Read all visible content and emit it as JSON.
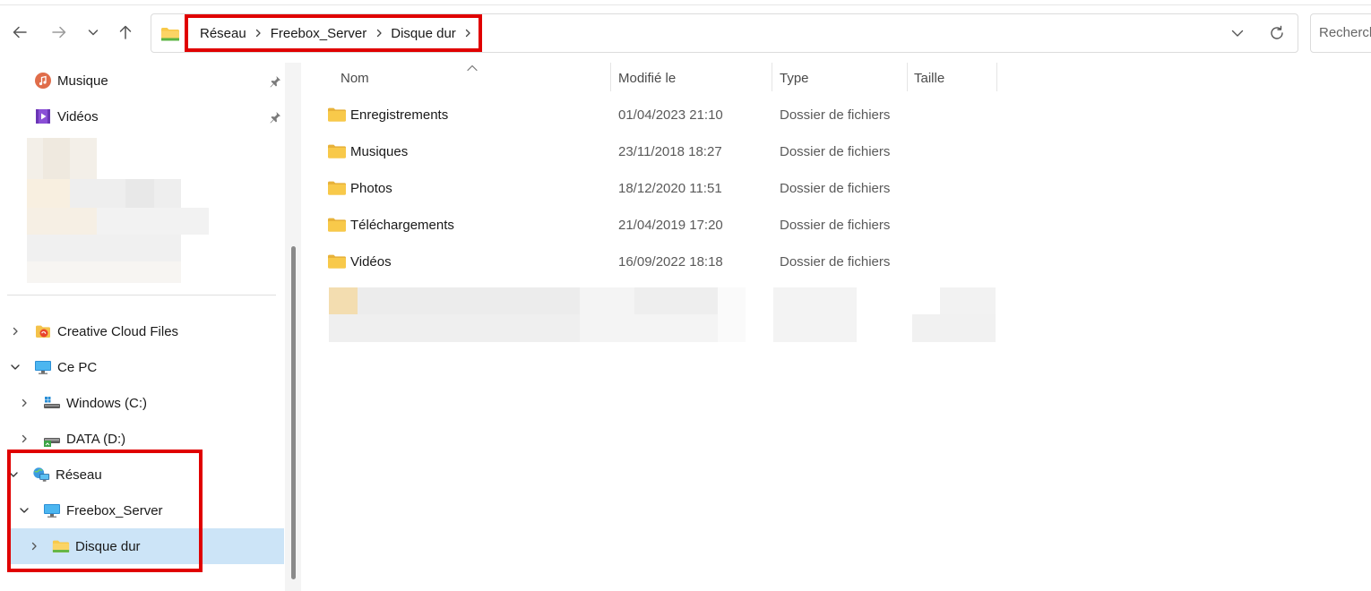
{
  "window": {
    "address": {
      "crumbs": [
        "Réseau",
        "Freebox_Server",
        "Disque dur"
      ]
    },
    "search": {
      "placeholder": "Rechercher"
    }
  },
  "icons": {
    "back": "arrow-left-icon",
    "forward": "arrow-right-icon",
    "recent": "chevron-down-icon",
    "up": "arrow-up-icon",
    "dropdown": "chevron-down-icon",
    "refresh": "refresh-icon",
    "pin": "pin-icon"
  },
  "colors": {
    "highlight": "#e00000",
    "selection": "#cce4f7",
    "folder": "#f8c94a"
  },
  "sidebar": {
    "quick_access": [
      {
        "label": "Musique",
        "icon": "music-icon",
        "pinned": true
      },
      {
        "label": "Vidéos",
        "icon": "video-icon",
        "pinned": true
      }
    ],
    "tree": [
      {
        "label": "Creative Cloud Files",
        "icon": "creative-cloud-icon",
        "expanded": false
      },
      {
        "label": "Ce PC",
        "icon": "computer-icon",
        "expanded": true
      },
      {
        "label": "Windows (C:)",
        "icon": "drive-icon",
        "expanded": false
      },
      {
        "label": "DATA (D:)",
        "icon": "drive-icon",
        "expanded": false
      },
      {
        "label": "Réseau",
        "icon": "network-icon",
        "expanded": true
      },
      {
        "label": "Freebox_Server",
        "icon": "computer-icon",
        "expanded": true
      },
      {
        "label": "Disque dur",
        "icon": "network-folder-icon",
        "expanded": false,
        "selected": true
      }
    ]
  },
  "filelist": {
    "columns": {
      "name": "Nom",
      "modified": "Modifié le",
      "type": "Type",
      "size": "Taille"
    },
    "rows": [
      {
        "name": "Enregistrements",
        "modified": "01/04/2023 21:10",
        "type": "Dossier de fichiers",
        "size": ""
      },
      {
        "name": "Musiques",
        "modified": "23/11/2018 18:27",
        "type": "Dossier de fichiers",
        "size": ""
      },
      {
        "name": "Photos",
        "modified": "18/12/2020 11:51",
        "type": "Dossier de fichiers",
        "size": ""
      },
      {
        "name": "Téléchargements",
        "modified": "21/04/2019 17:20",
        "type": "Dossier de fichiers",
        "size": ""
      },
      {
        "name": "Vidéos",
        "modified": "16/09/2022 18:18",
        "type": "Dossier de fichiers",
        "size": ""
      }
    ]
  }
}
